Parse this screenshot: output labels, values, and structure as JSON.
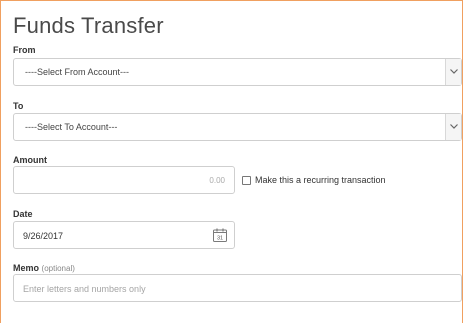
{
  "title": "Funds Transfer",
  "from": {
    "label": "From",
    "selected": "----Select From Account---"
  },
  "to": {
    "label": "To",
    "selected": "----Select To Account---"
  },
  "amount": {
    "label": "Amount",
    "value": "0.00"
  },
  "recurring": {
    "label": "Make this a recurring transaction",
    "checked": false
  },
  "date": {
    "label": "Date",
    "value": "9/26/2017",
    "calendar_day": "31",
    "icon": "calendar-icon"
  },
  "memo": {
    "label": "Memo",
    "optional": "(optional)",
    "placeholder": "Enter letters and numbers only"
  },
  "colors": {
    "panel_border": "#f0a060",
    "input_border": "#cfcfcf",
    "text": "#333333"
  }
}
